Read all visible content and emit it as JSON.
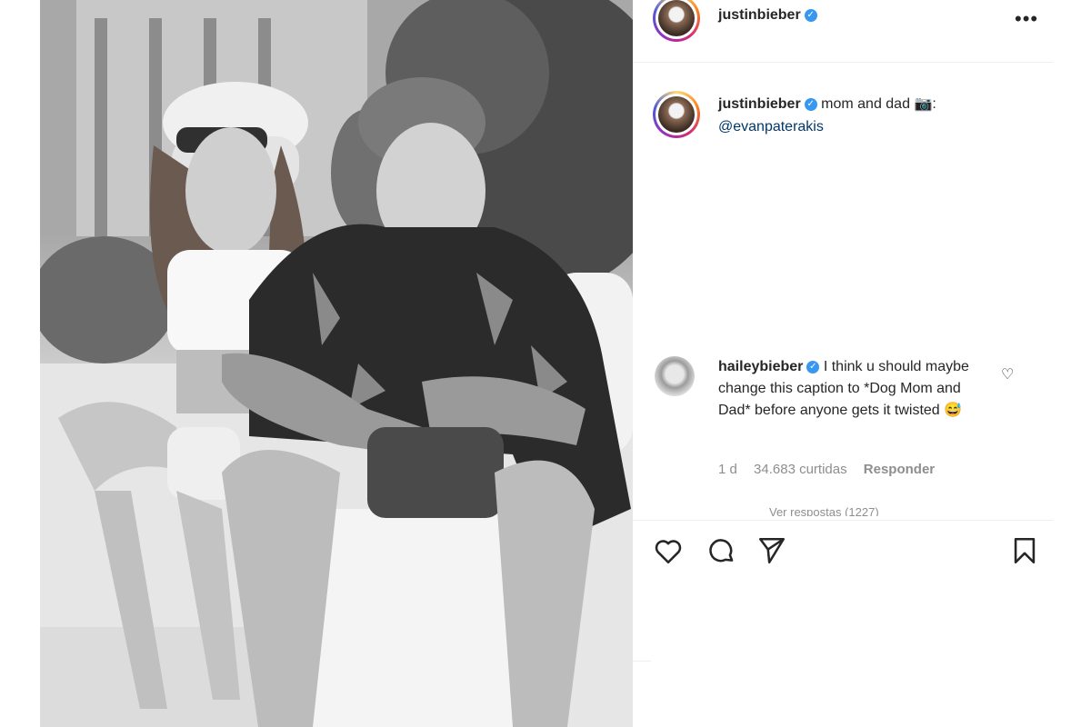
{
  "post": {
    "author": {
      "username": "justinbieber",
      "verified_icon": "verified-badge-icon"
    },
    "caption": {
      "username": "justinbieber",
      "text": "mom and dad",
      "emoji": "📷",
      "colon": ":",
      "mention": "@evanpaterakis"
    },
    "comment": {
      "username": "haileybieber",
      "text": "I think u should maybe change this caption to *Dog Mom and Dad* before anyone gets it twisted",
      "emoji": "😅",
      "age": "1 d",
      "likes": "34.683 curtidas",
      "reply_label": "Responder",
      "view_replies": "Ver respostas (1227)"
    },
    "icons": {
      "more": "more-options-icon",
      "like": "heart-icon",
      "comment": "comment-bubble-icon",
      "share": "paper-plane-icon",
      "save": "bookmark-icon"
    }
  },
  "colors": {
    "text": "#262626",
    "secondary": "#8e8e8e",
    "verified": "#3897f0",
    "mention": "#00376b",
    "border": "#efefef"
  }
}
